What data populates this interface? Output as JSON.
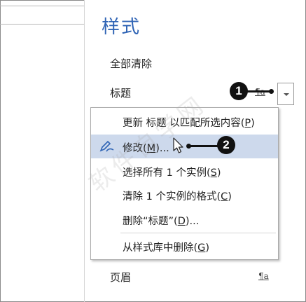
{
  "pane": {
    "title": "样式",
    "rows": [
      {
        "label": "全部清除"
      },
      {
        "label": "标题",
        "mark": "¶a"
      },
      {
        "label": "页眉",
        "mark": "¶a"
      }
    ]
  },
  "menu": {
    "items": [
      {
        "text": "更新 标题 以匹配所选内容(",
        "key": "P",
        "suffix": ")"
      },
      {
        "text": "修改(",
        "key": "M",
        "suffix": ")..."
      },
      {
        "text": "选择所有 1 个实例(",
        "key": "S",
        "suffix": ")"
      },
      {
        "text": "清除 1 个实例的格式(",
        "key": "C",
        "suffix": ")"
      },
      {
        "text": "删除“标题”(",
        "key": "D",
        "suffix": ")..."
      },
      {
        "text": "从样式库中删除(",
        "key": "G",
        "suffix": ")"
      }
    ]
  },
  "callouts": {
    "one": "1",
    "two": "2"
  },
  "watermark": "软件自学网",
  "colors": {
    "title": "#2f64b5",
    "highlight": "#cdd9ec"
  },
  "icons": {
    "modify": "pen-edit-icon",
    "cursor": "mouse-pointer-icon",
    "dropdown": "chevron-down-icon"
  }
}
